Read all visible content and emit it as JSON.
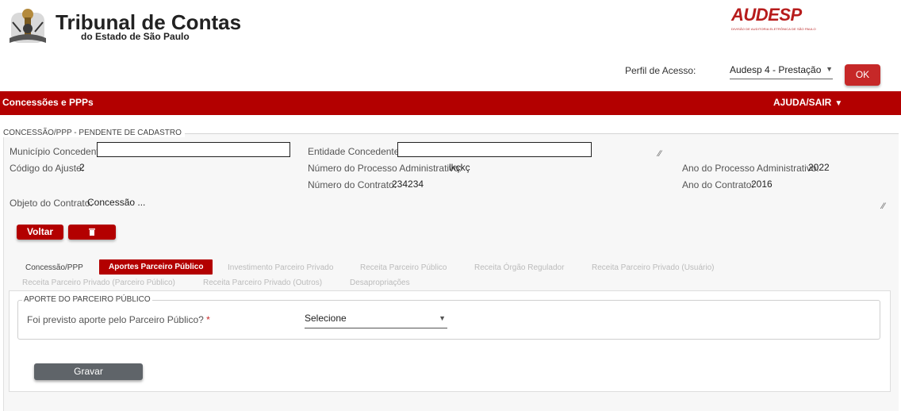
{
  "header": {
    "brand_title": "Tribunal de Contas",
    "brand_subtitle": "do Estado de São Paulo",
    "audesp_logo": "AUDESP",
    "audesp_tagline": "DIVISÃO DE AUDITORIA ELETRÔNICA DE SÃO PAULO",
    "perfil_label": "Perfil de Acesso:",
    "perfil_value": "Audesp 4 - Prestação",
    "ok_label": "OK"
  },
  "nav": {
    "title": "Concessões e PPPs",
    "help_label": "AJUDA/SAIR",
    "help_icon": "caret-down-icon"
  },
  "main": {
    "legend": "CONCESSÃO/PPP - PENDENTE DE CADASTRO",
    "fields": {
      "municipio_label": "Município Concedente:",
      "municipio_value": "",
      "entidade_label": "Entidade Concedente:",
      "entidade_value": "",
      "codigo_label": "Código do Ajuste:",
      "codigo_value": "2",
      "num_processo_label": "Número do Processo Administrativo:",
      "num_processo_value": "lkçkç",
      "ano_processo_label": "Ano do Processo Administrativo:",
      "ano_processo_value": "2022",
      "num_contrato_label": "Número do Contrato:",
      "num_contrato_value": "234234",
      "ano_contrato_label": "Ano do Contrato:",
      "ano_contrato_value": "2016",
      "objeto_label": "Objeto do Contrato:",
      "objeto_value": "Concessão ..."
    },
    "voltar_label": "Voltar",
    "delete_icon": "trash-icon",
    "tabs": [
      {
        "label": "Concessão/PPP",
        "state": "normal"
      },
      {
        "label": "Aportes Parceiro Público",
        "state": "active"
      },
      {
        "label": "Investimento Parceiro Privado",
        "state": "disabled"
      },
      {
        "label": "Receita Parceiro Público",
        "state": "disabled"
      },
      {
        "label": "Receita Órgão Regulador",
        "state": "disabled"
      },
      {
        "label": "Receita Parceiro Privado (Usuário)",
        "state": "disabled"
      },
      {
        "label": "Receita Parceiro Privado (Parceiro Público)",
        "state": "disabled"
      },
      {
        "label": "Receita Parceiro Privado (Outros)",
        "state": "disabled"
      },
      {
        "label": "Desapropriações",
        "state": "disabled"
      }
    ],
    "aporte": {
      "legend": "APORTE DO PARCEIRO PÚBLICO",
      "question": "Foi previsto aporte pelo Parceiro Público?",
      "required_mark": "*",
      "select_value": "Selecione"
    },
    "gravar_label": "Gravar"
  },
  "colors": {
    "brand_red": "#b30000",
    "button_gray": "#5f6469"
  }
}
